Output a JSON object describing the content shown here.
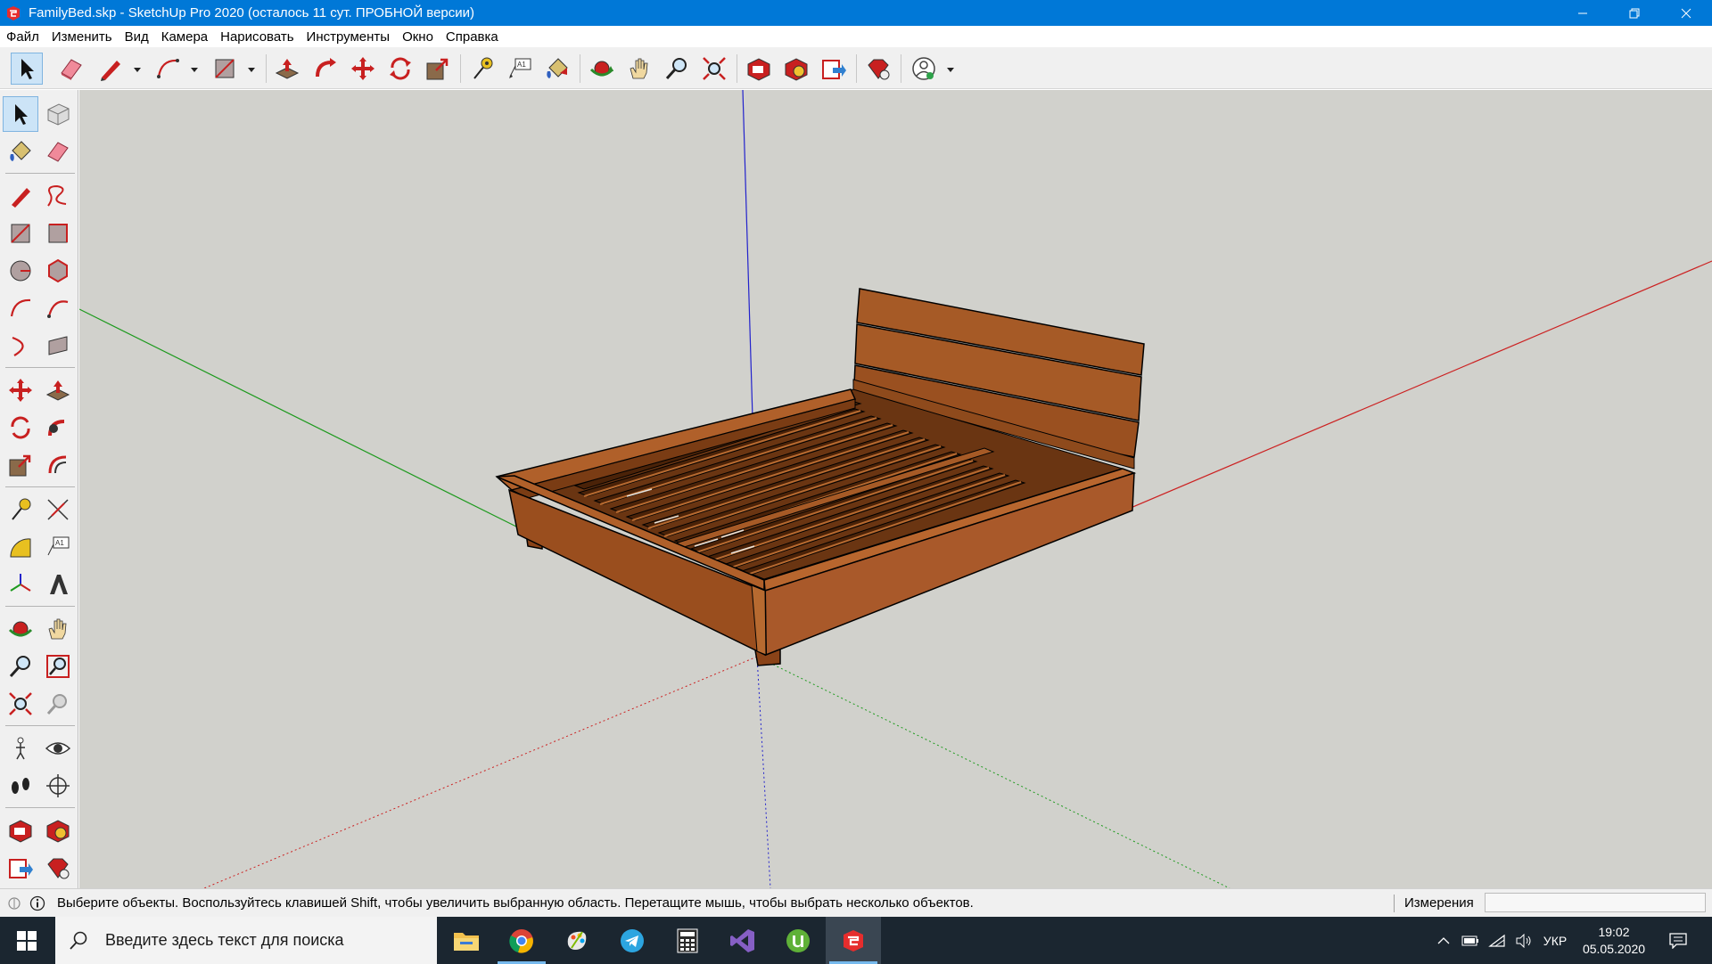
{
  "window": {
    "title": "FamilyBed.skp - SketchUp Pro 2020 (осталось 11 сут. ПРОБНОЙ версии)",
    "controls": [
      "minimize",
      "restore",
      "close"
    ]
  },
  "menu": {
    "items": [
      "Файл",
      "Изменить",
      "Вид",
      "Камера",
      "Нарисовать",
      "Инструменты",
      "Окно",
      "Справка"
    ]
  },
  "toolbar": {
    "tools": [
      "select",
      "eraser",
      "line",
      "arc",
      "rectangle",
      "push-pull",
      "follow-me",
      "move",
      "rotate",
      "scale",
      "tape-measure",
      "text",
      "paint-bucket",
      "orbit",
      "pan",
      "zoom",
      "zoom-extents",
      "3d-warehouse",
      "extension-warehouse",
      "layout",
      "extension-manager",
      "account"
    ],
    "active_tool": "select"
  },
  "left_toolbar": {
    "tools": [
      "select",
      "make-component",
      "paint-bucket",
      "eraser",
      "line",
      "freehand",
      "rectangle",
      "rotated-rectangle",
      "circle",
      "polygon",
      "arc",
      "2-point-arc",
      "3-point-arc",
      "pie",
      "move",
      "push-pull",
      "rotate",
      "follow-me",
      "scale",
      "offset",
      "tape-measure",
      "dimension",
      "protractor",
      "text",
      "axes",
      "3d-text",
      "orbit",
      "pan",
      "zoom",
      "zoom-window",
      "zoom-extents",
      "previous-view",
      "position-camera",
      "look-around",
      "walk",
      "section-plane",
      "3d-warehouse",
      "extension-warehouse",
      "layout",
      "extension-manager"
    ],
    "active_tool": "select"
  },
  "colors": {
    "title_bar": "#0078d7",
    "viewport_background": "#d1d1cc",
    "axis_red": "#cc2222",
    "axis_green": "#1e9a1e",
    "axis_blue": "#2222cc",
    "wood": "#a3531f",
    "taskbar": "#1b2630"
  },
  "status": {
    "text": "Выберите объекты. Воспользуйтесь клавишей Shift, чтобы увеличить выбранную область. Перетащите мышь, чтобы выбрать несколько объектов.",
    "measurements_label": "Измерения",
    "measurements_value": ""
  },
  "taskbar": {
    "search_placeholder": "Введите здесь текст для поиска",
    "apps": [
      "file-explorer",
      "chrome",
      "paint-3d",
      "telegram",
      "calculator",
      "visual-studio",
      "utorrent",
      "sketchup"
    ],
    "language": "УКР",
    "time": "19:02",
    "date": "05.05.2020"
  }
}
